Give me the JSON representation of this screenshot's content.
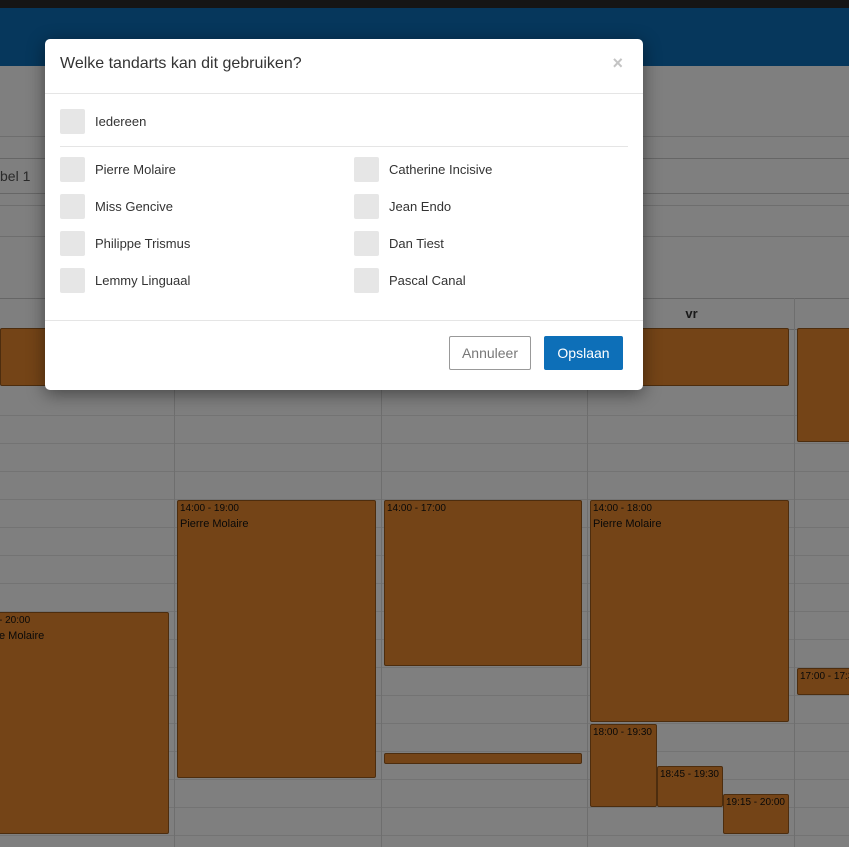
{
  "background": {
    "field_fragment": "bel 1",
    "calendar": {
      "day_label": "vr",
      "events": [
        {
          "time": "- 20:00",
          "name": "e Molaire"
        },
        {
          "time": "14:00 - 19:00",
          "name": "Pierre Molaire"
        },
        {
          "time": "14:00 - 17:00",
          "name": ""
        },
        {
          "time": "14:00 - 18:00",
          "name": "Pierre Molaire"
        },
        {
          "time": "18:00 - 19:30",
          "name": ""
        },
        {
          "time": "18:45 - 19:30",
          "name": ""
        },
        {
          "time": "19:15 - 20:00",
          "name": ""
        },
        {
          "time": "17:00 - 17:3",
          "name": ""
        }
      ]
    }
  },
  "modal": {
    "title": "Welke tandarts kan dit gebruiken?",
    "close_symbol": "×",
    "everyone_label": "Iedereen",
    "dentists_left": [
      "Pierre Molaire",
      "Miss Gencive",
      "Philippe Trismus",
      "Lemmy Linguaal"
    ],
    "dentists_right": [
      "Catherine Incisive",
      "Jean Endo",
      "Dan Tiest",
      "Pascal Canal"
    ],
    "cancel_label": "Annuleer",
    "save_label": "Opslaan"
  },
  "colors": {
    "primary": "#0d6fb8",
    "event_fill": "#e8892f",
    "checkbox": "#e6e6e6"
  }
}
